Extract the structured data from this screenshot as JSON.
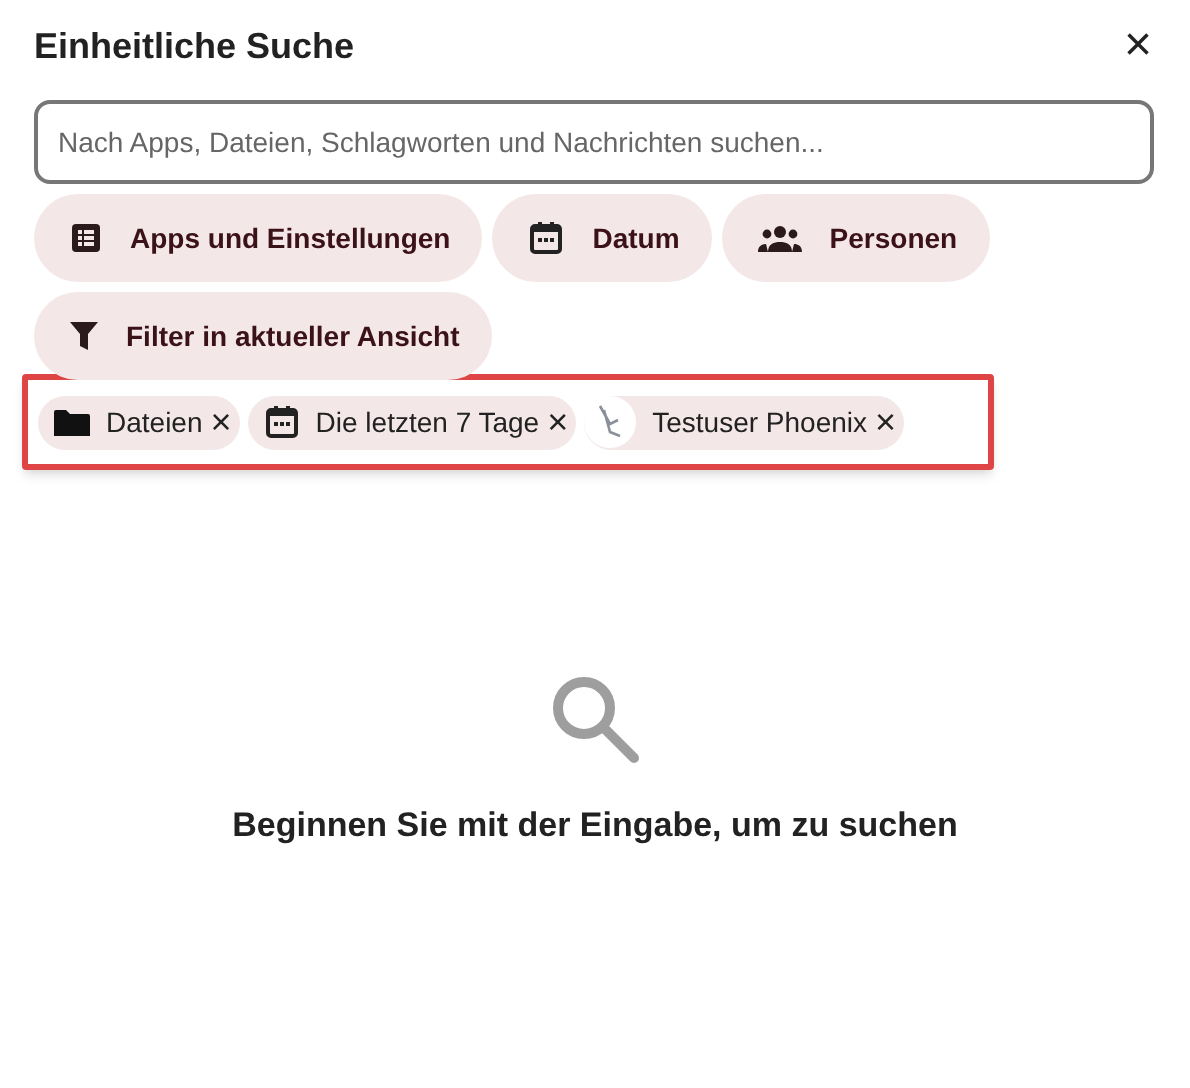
{
  "dialog": {
    "title": "Einheitliche Suche",
    "close": "×"
  },
  "search": {
    "placeholder": "Nach Apps, Dateien, Schlagworten und Nachrichten suchen..."
  },
  "filters": [
    {
      "kind": "apps",
      "label": "Apps und Einstellungen"
    },
    {
      "kind": "date",
      "label": "Datum"
    },
    {
      "kind": "people",
      "label": "Personen"
    },
    {
      "kind": "filter",
      "label": "Filter in aktueller Ansicht"
    }
  ],
  "active_filters": [
    {
      "kind": "folder",
      "label": "Dateien",
      "remove": "×"
    },
    {
      "kind": "date",
      "label": "Die letzten 7 Tage",
      "remove": "×"
    },
    {
      "kind": "avatar",
      "label": "Testuser Phoenix",
      "remove": "×"
    }
  ],
  "empty_state": {
    "message": "Beginnen Sie mit der Eingabe, um zu suchen"
  }
}
